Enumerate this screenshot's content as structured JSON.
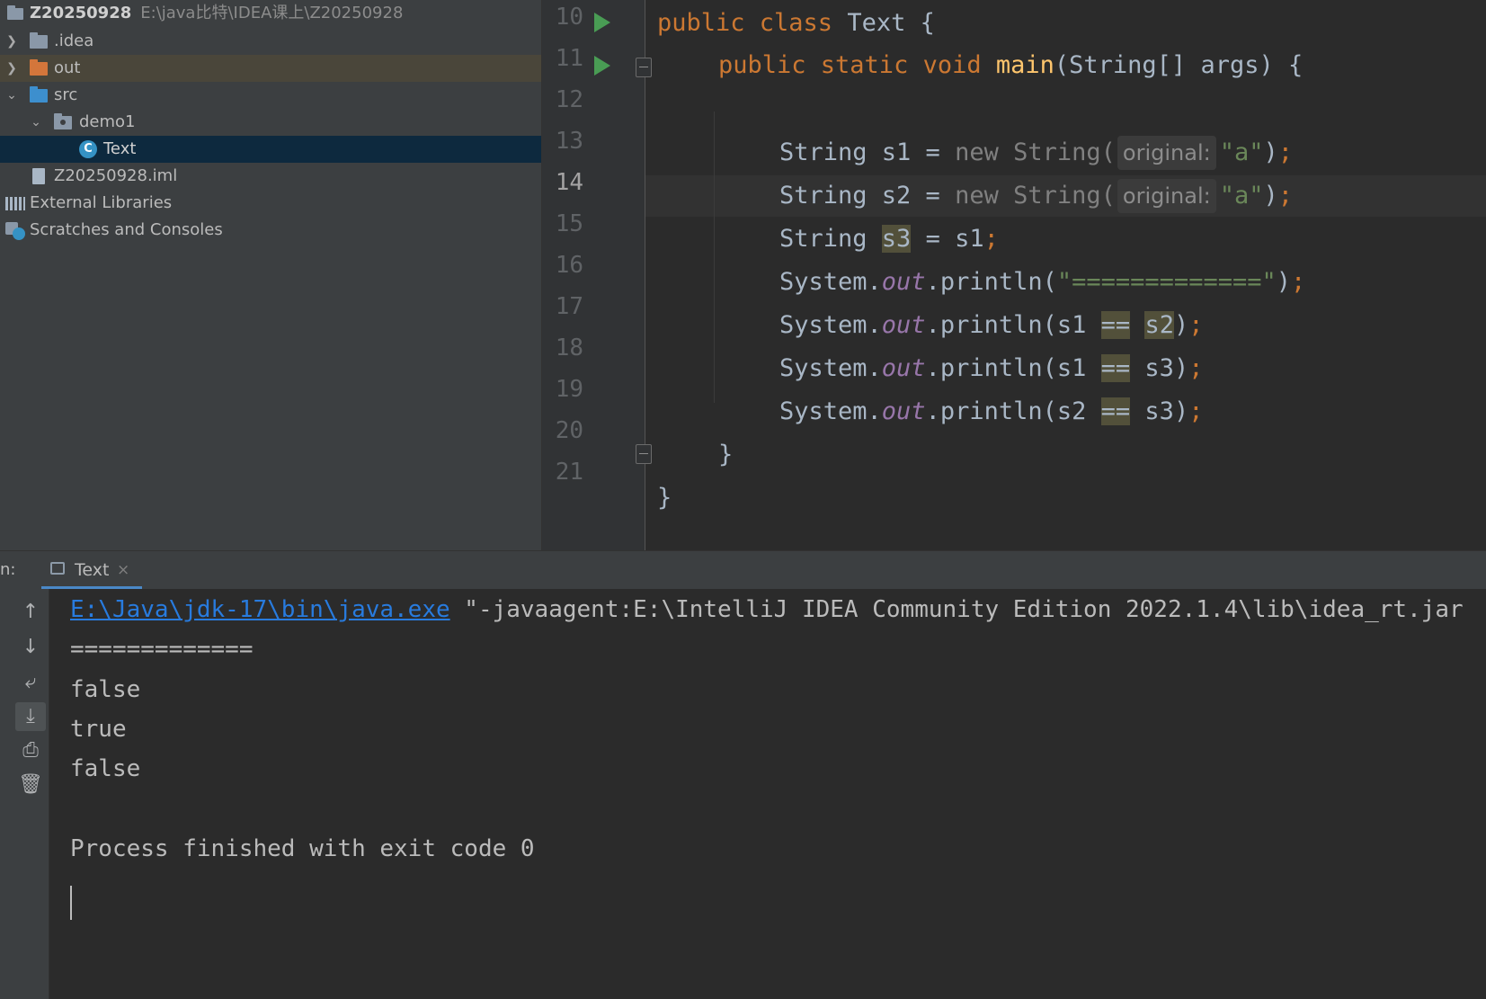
{
  "project_panel": {
    "root": {
      "name": "Z20250928",
      "path": "E:\\java比特\\IDEA课上\\Z20250928"
    },
    "items": [
      {
        "label": ".idea",
        "icon": "folder-icon"
      },
      {
        "label": "out",
        "icon": "folder-orange-icon"
      },
      {
        "label": "src",
        "icon": "folder-blue-icon"
      },
      {
        "label": "demo1",
        "icon": "package-icon"
      },
      {
        "label": "Text",
        "icon": "java-class-icon"
      },
      {
        "label": "Z20250928.iml",
        "icon": "iml-file-icon"
      },
      {
        "label": "External Libraries",
        "icon": "libraries-icon"
      },
      {
        "label": "Scratches and Consoles",
        "icon": "scratches-icon"
      }
    ]
  },
  "editor": {
    "line_numbers": [
      "10",
      "11",
      "12",
      "13",
      "14",
      "15",
      "16",
      "17",
      "18",
      "19",
      "20",
      "21"
    ],
    "current_line": "14",
    "hint_label": "original:",
    "code": {
      "l10": {
        "a": "public class ",
        "b": "Text",
        "c": " {"
      },
      "l11": {
        "a": "public static void ",
        "b": "main",
        "c": "(String[] args) {"
      },
      "l13": {
        "a": "String s1 = ",
        "b": "new",
        "c": " String(",
        "d": "\"a\"",
        "e": ")",
        "f": ";"
      },
      "l14": {
        "a": "String s2 = ",
        "b": "new",
        "c": " String(",
        "d": "\"a\"",
        "e": ")",
        "f": ";"
      },
      "l15": {
        "a": "String ",
        "b": "s3",
        "c": " = s1",
        "d": ";"
      },
      "l16": {
        "a": "System.",
        "b": "out",
        "c": ".println(",
        "d": "\"=============\"",
        "e": ")",
        "f": ";"
      },
      "l17": {
        "a": "System.",
        "b": "out",
        "c": ".println(s1 ",
        "d": "==",
        "e": " ",
        "f": "s2",
        "g": ")",
        "h": ";"
      },
      "l18": {
        "a": "System.",
        "b": "out",
        "c": ".println(s1 ",
        "d": "==",
        "e": " s3)",
        "f": ";"
      },
      "l19": {
        "a": "System.",
        "b": "out",
        "c": ".println(s2 ",
        "d": "==",
        "e": " s3)",
        "f": ";"
      },
      "l20": "}",
      "l21": "}"
    }
  },
  "run_window": {
    "prefix": "n:",
    "tab_label": "Text",
    "tab_close": "×",
    "toolbar": [
      "arrow-up-icon",
      "arrow-down-icon",
      "soft-wrap-icon",
      "scroll-to-end-icon",
      "print-icon",
      "trash-icon"
    ],
    "console": {
      "java_path": "E:\\Java\\jdk-17\\bin\\java.exe",
      "cmd_rest": " \"-javaagent:E:\\IntelliJ IDEA Community Edition 2022.1.4\\lib\\idea_rt.jar",
      "lines": [
        "=============",
        "false",
        "true",
        "false",
        "",
        "Process finished with exit code 0"
      ]
    }
  },
  "colors": {
    "keyword": "#cc7832",
    "function": "#ffc66d",
    "string": "#6a8759",
    "field": "#9876aa",
    "link": "#287bde",
    "run": "#499c54"
  }
}
